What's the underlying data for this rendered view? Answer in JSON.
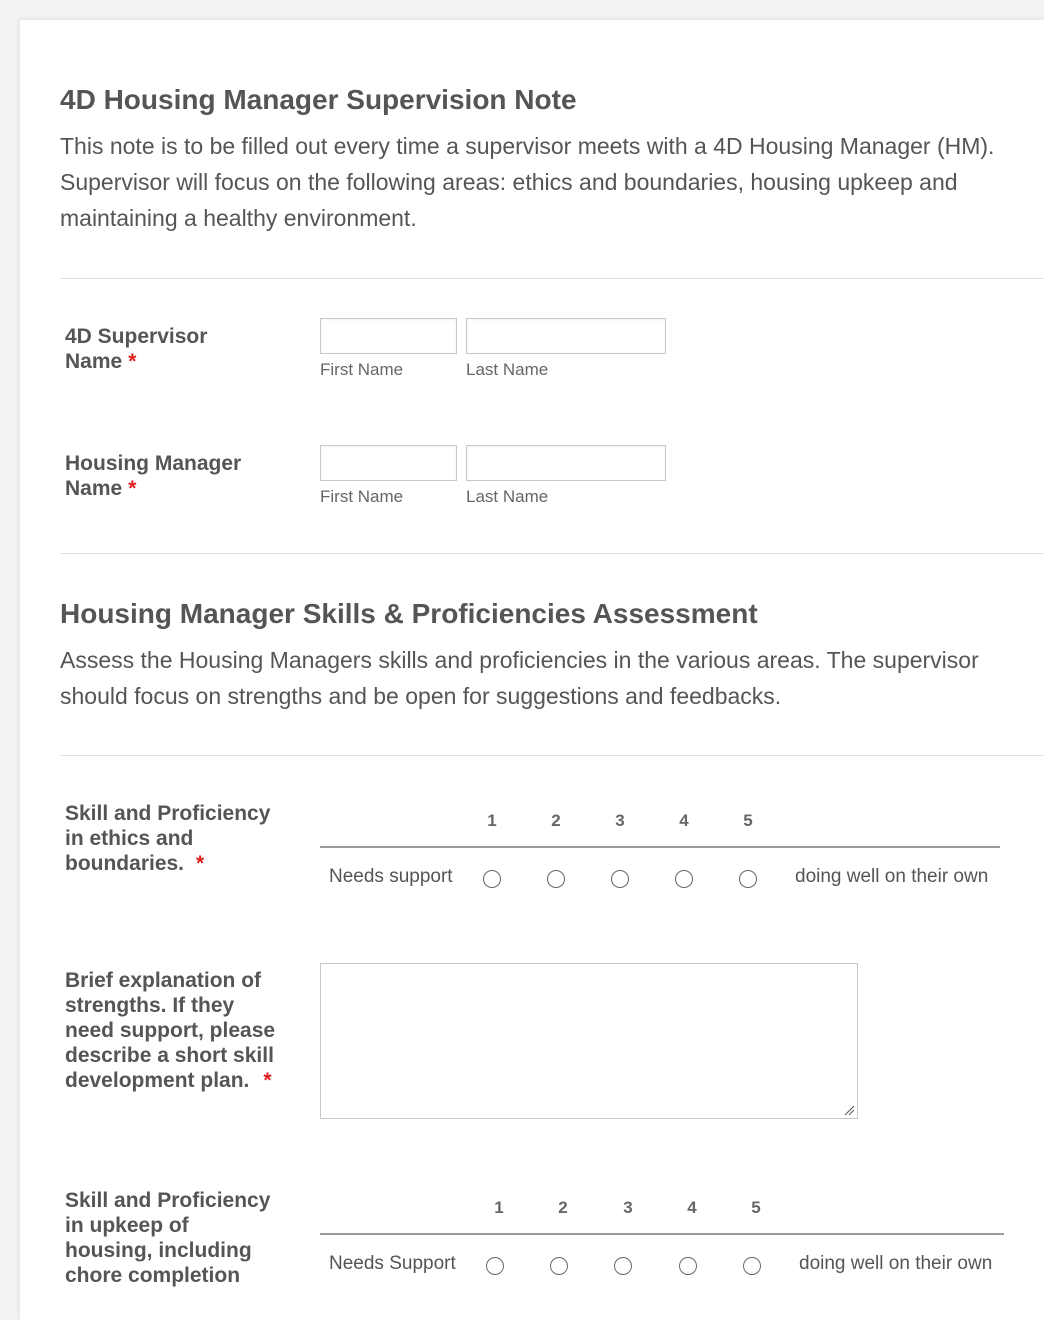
{
  "form": {
    "title": "4D Housing Manager Supervision Note",
    "description_lines": [
      "This note is to be filled out every time a supervisor meets with a 4D Housing Manager (HM).",
      "Supervisor will focus on the following areas: ethics and boundaries, housing upkeep and",
      "maintaining a healthy environment."
    ],
    "supervisor_name": {
      "label_lines": [
        "4D Supervisor",
        "Name"
      ],
      "required_mark": "*",
      "first_sublabel": "First Name",
      "last_sublabel": "Last Name",
      "first_value": "",
      "last_value": ""
    },
    "manager_name": {
      "label_lines": [
        "Housing Manager",
        "Name"
      ],
      "required_mark": "*",
      "first_sublabel": "First Name",
      "last_sublabel": "Last Name",
      "first_value": "",
      "last_value": ""
    },
    "section2": {
      "title": "Housing Manager Skills & Proficiencies Assessment",
      "description_lines": [
        "Assess the Housing Managers skills and proficiencies in the various areas. The supervisor",
        "should focus on strengths and be open for suggestions and feedbacks."
      ]
    },
    "scale_ethics": {
      "label_lines": [
        "Skill and Proficiency",
        "in ethics and",
        "boundaries."
      ],
      "required_mark": "*",
      "low_label": "Needs support",
      "high_label": "doing well on their own",
      "options": [
        "1",
        "2",
        "3",
        "4",
        "5"
      ],
      "selected": null
    },
    "explanation": {
      "label_lines": [
        "Brief explanation of",
        "strengths. If they",
        "need support, please",
        "describe a short skill",
        "development plan."
      ],
      "required_mark": "*",
      "value": ""
    },
    "scale_upkeep": {
      "label_lines": [
        "Skill and Proficiency",
        "in upkeep of",
        "housing, including",
        "chore completion"
      ],
      "low_label": "Needs Support",
      "high_label": "doing well on their own",
      "options": [
        "1",
        "2",
        "3",
        "4",
        "5"
      ],
      "selected": null
    }
  }
}
